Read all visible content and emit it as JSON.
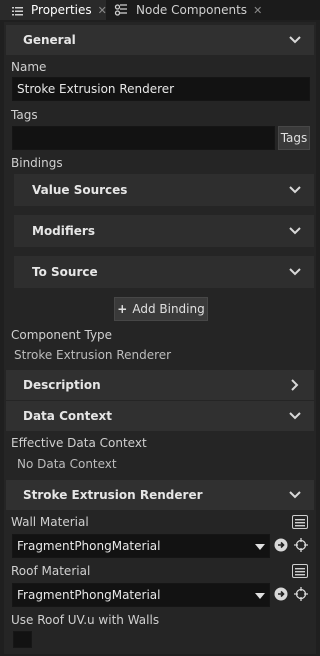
{
  "tabs": [
    {
      "label": "Properties",
      "icon": "list-icon",
      "active": true
    },
    {
      "label": "Node Components",
      "icon": "components-icon",
      "active": false
    }
  ],
  "general": {
    "title": "General",
    "name_label": "Name",
    "name_value": "Stroke Extrusion Renderer",
    "tags_label": "Tags",
    "tags_value": "",
    "tags_button": "Tags",
    "bindings_label": "Bindings",
    "binding_sections": [
      "Value Sources",
      "Modifiers",
      "To Source"
    ],
    "add_binding": "Add Binding",
    "component_type_label": "Component Type",
    "component_type_value": "Stroke Extrusion Renderer"
  },
  "description": {
    "title": "Description"
  },
  "data_context": {
    "title": "Data Context",
    "effective_label": "Effective Data Context",
    "effective_value": "No Data Context"
  },
  "renderer": {
    "title": "Stroke Extrusion Renderer",
    "wall_label": "Wall Material",
    "wall_value": "FragmentPhongMaterial",
    "roof_label": "Roof Material",
    "roof_value": "FragmentPhongMaterial",
    "use_roof_uv_label": "Use Roof UV.u with Walls",
    "use_roof_uv_checked": false
  },
  "colors": {
    "background": "#1f1f1f",
    "panel": "#252525",
    "section_header": "#303030",
    "field": "#121212",
    "text": "#d6d6d6"
  }
}
